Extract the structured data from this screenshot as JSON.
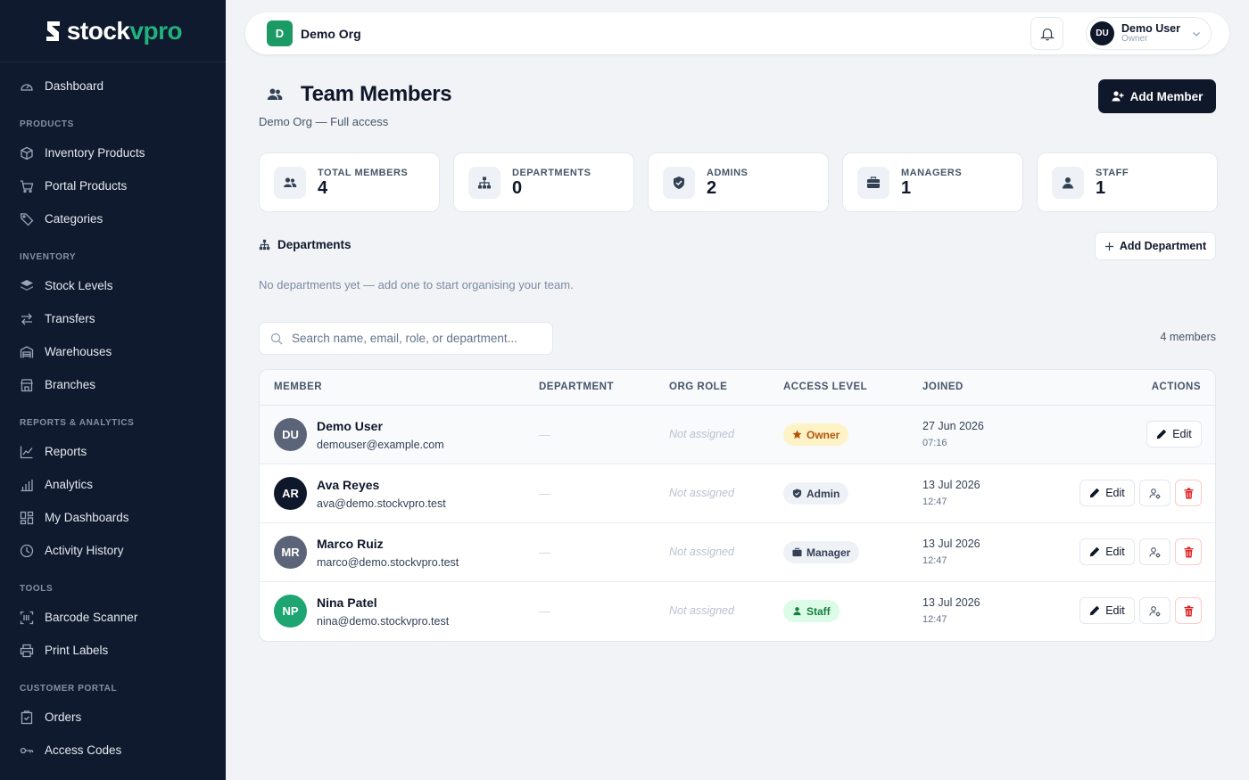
{
  "brand": {
    "part1": "stock",
    "part2": "vpro",
    "accent": "#22b07d"
  },
  "sidebar": {
    "top": [
      {
        "label": "Dashboard",
        "icon": "gauge-icon"
      }
    ],
    "sections": [
      {
        "title": "PRODUCTS",
        "items": [
          {
            "label": "Inventory Products",
            "icon": "box-icon"
          },
          {
            "label": "Portal Products",
            "icon": "cart-icon"
          },
          {
            "label": "Categories",
            "icon": "tag-icon"
          }
        ]
      },
      {
        "title": "INVENTORY",
        "items": [
          {
            "label": "Stock Levels",
            "icon": "layers-icon"
          },
          {
            "label": "Transfers",
            "icon": "arrows-icon"
          },
          {
            "label": "Warehouses",
            "icon": "warehouse-icon"
          },
          {
            "label": "Branches",
            "icon": "store-icon"
          }
        ]
      },
      {
        "title": "REPORTS & ANALYTICS",
        "items": [
          {
            "label": "Reports",
            "icon": "line-chart-icon"
          },
          {
            "label": "Analytics",
            "icon": "bar-chart-icon"
          },
          {
            "label": "My Dashboards",
            "icon": "grid-icon"
          },
          {
            "label": "Activity History",
            "icon": "clock-icon"
          }
        ]
      },
      {
        "title": "TOOLS",
        "items": [
          {
            "label": "Barcode Scanner",
            "icon": "barcode-icon"
          },
          {
            "label": "Print Labels",
            "icon": "printer-icon"
          }
        ]
      },
      {
        "title": "CUSTOMER PORTAL",
        "items": [
          {
            "label": "Orders",
            "icon": "clipboard-icon"
          },
          {
            "label": "Access Codes",
            "icon": "key-icon"
          }
        ]
      }
    ]
  },
  "topbar": {
    "org_initial": "D",
    "org_name": "Demo Org",
    "user_initials": "DU",
    "user_name": "Demo User",
    "user_role": "Owner"
  },
  "header": {
    "title": "Team Members",
    "subtitle": "Demo Org — Full access",
    "add_member_label": "Add Member"
  },
  "stats": [
    {
      "label": "TOTAL MEMBERS",
      "value": "4"
    },
    {
      "label": "DEPARTMENTS",
      "value": "0"
    },
    {
      "label": "ADMINS",
      "value": "2"
    },
    {
      "label": "MANAGERS",
      "value": "1"
    },
    {
      "label": "STAFF",
      "value": "1"
    }
  ],
  "departments": {
    "title": "Departments",
    "add_label": "Add Department",
    "empty": "No departments yet — add one to start organising your team."
  },
  "search": {
    "placeholder": "Search name, email, role, or department...",
    "count": "4 members"
  },
  "table": {
    "columns": {
      "member": "MEMBER",
      "department": "DEPARTMENT",
      "org_role": "ORG ROLE",
      "access": "ACCESS LEVEL",
      "joined": "JOINED",
      "actions": "ACTIONS"
    },
    "edit_label": "Edit",
    "rows": [
      {
        "initials": "DU",
        "name": "Demo User",
        "email": "demouser@example.com",
        "department": "—",
        "org_role": "Not assigned",
        "access": "Owner",
        "date": "27 Jun 2026",
        "time": "07:16",
        "avatar_color": "#5b6478"
      },
      {
        "initials": "AR",
        "name": "Ava Reyes",
        "email": "ava@demo.stockvpro.test",
        "department": "—",
        "org_role": "Not assigned",
        "access": "Admin",
        "date": "13 Jul 2026",
        "time": "12:47",
        "avatar_color": "#0f172a"
      },
      {
        "initials": "MR",
        "name": "Marco Ruiz",
        "email": "marco@demo.stockvpro.test",
        "department": "—",
        "org_role": "Not assigned",
        "access": "Manager",
        "date": "13 Jul 2026",
        "time": "12:47",
        "avatar_color": "#5b6478"
      },
      {
        "initials": "NP",
        "name": "Nina Patel",
        "email": "nina@demo.stockvpro.test",
        "department": "—",
        "org_role": "Not assigned",
        "access": "Staff",
        "date": "13 Jul 2026",
        "time": "12:47",
        "avatar_color": "#1ea672"
      }
    ]
  }
}
